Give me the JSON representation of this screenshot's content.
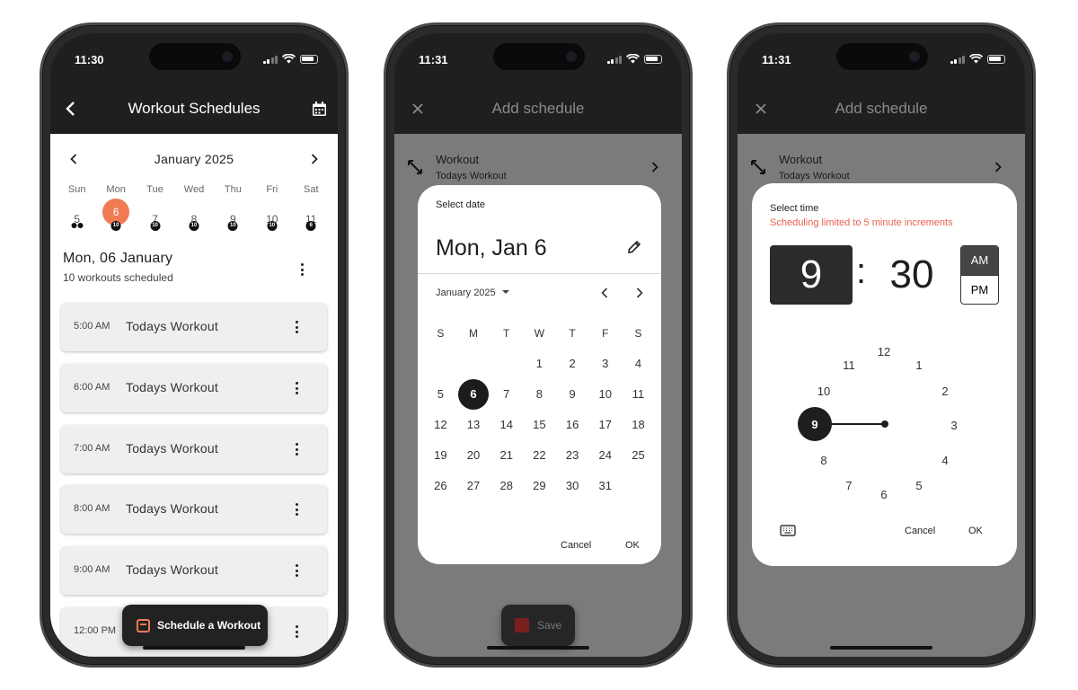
{
  "status": {
    "time_1": "11:30",
    "time_2": "11:31",
    "time_3": "11:31"
  },
  "screen1": {
    "title": "Workout Schedules",
    "month": "January 2025",
    "week": [
      {
        "name": "Sun",
        "num": "5",
        "badge": ""
      },
      {
        "name": "Mon",
        "num": "6",
        "badge": "10"
      },
      {
        "name": "Tue",
        "num": "7",
        "badge": "10"
      },
      {
        "name": "Wed",
        "num": "8",
        "badge": "10"
      },
      {
        "name": "Thu",
        "num": "9",
        "badge": "10"
      },
      {
        "name": "Fri",
        "num": "10",
        "badge": "10"
      },
      {
        "name": "Sat",
        "num": "11",
        "badge": "6"
      }
    ],
    "day_heading": "Mon, 06 January",
    "day_subheading": "10 workouts scheduled",
    "workouts": [
      {
        "time": "5:00 AM",
        "name": "Todays Workout"
      },
      {
        "time": "6:00 AM",
        "name": "Todays Workout"
      },
      {
        "time": "7:00 AM",
        "name": "Todays Workout"
      },
      {
        "time": "8:00 AM",
        "name": "Todays Workout"
      },
      {
        "time": "9:00 AM",
        "name": "Todays Workout"
      },
      {
        "time": "12:00 PM",
        "name": ""
      }
    ],
    "fab_label": "Schedule a Workout",
    "accent": "#f07a52"
  },
  "screen2": {
    "title": "Add schedule",
    "row_label": "Workout",
    "row_value": "Todays Workout",
    "dialog_label": "Select date",
    "big_date": "Mon, Jan 6",
    "month_select": "January 2025",
    "weekday_headers": [
      "S",
      "M",
      "T",
      "W",
      "T",
      "F",
      "S"
    ],
    "weeks": [
      [
        "",
        "",
        "",
        "1",
        "2",
        "3",
        "4"
      ],
      [
        "5",
        "6",
        "7",
        "8",
        "9",
        "10",
        "11"
      ],
      [
        "12",
        "13",
        "14",
        "15",
        "16",
        "17",
        "18"
      ],
      [
        "19",
        "20",
        "21",
        "22",
        "23",
        "24",
        "25"
      ],
      [
        "26",
        "27",
        "28",
        "29",
        "30",
        "31",
        ""
      ]
    ],
    "selected_day": "6",
    "cancel": "Cancel",
    "ok": "OK",
    "save": "Save"
  },
  "screen3": {
    "title": "Add schedule",
    "row_label": "Workout",
    "row_value": "Todays Workout",
    "dialog_label": "Select time",
    "warning": "Scheduling limited to 5 minute increments",
    "warning_color": "#e8604c",
    "hour": "9",
    "minute": "30",
    "am": "AM",
    "pm": "PM",
    "selected_period": "AM",
    "clock_numbers": [
      "12",
      "1",
      "2",
      "3",
      "4",
      "5",
      "6",
      "7",
      "8",
      "9",
      "10",
      "11"
    ],
    "selected_clock_number": "9",
    "cancel": "Cancel",
    "ok": "OK"
  }
}
